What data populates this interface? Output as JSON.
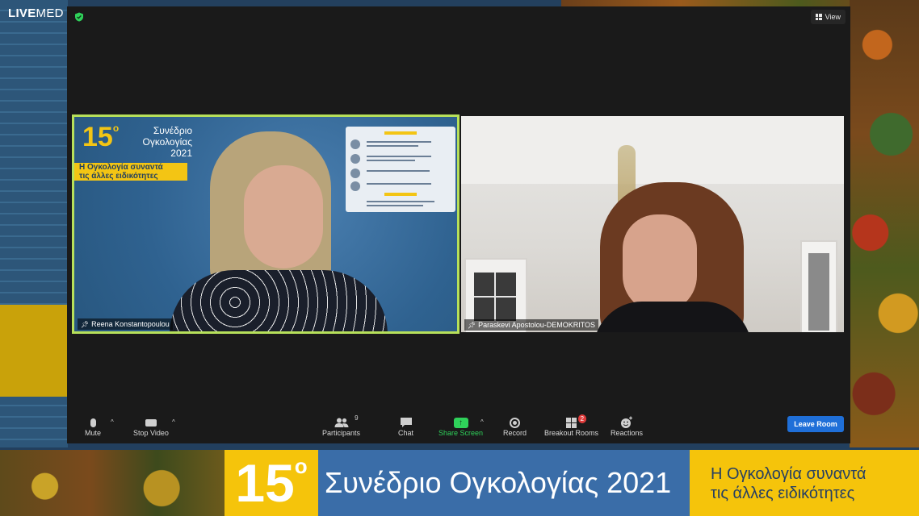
{
  "brand": {
    "live": "LIVE",
    "med": "MED"
  },
  "meeting": {
    "view_label": "View",
    "participants": [
      {
        "name": "Reena Konstantopoulou",
        "active_speaker": true
      },
      {
        "name": "Paraskevi Apostolou-DEMOKRITOS",
        "active_speaker": false
      }
    ],
    "tile1_poster": {
      "number": "15",
      "degree": "o",
      "line1": "Συνέδριο",
      "line2": "Ογκολογίας",
      "line3": "2021",
      "band1": "Η Ογκολογία συναντά",
      "band2": "τις άλλες ειδικότητες"
    },
    "toolbar": {
      "mute": "Mute",
      "stop_video": "Stop Video",
      "participants": "Participants",
      "participants_count": "9",
      "chat": "Chat",
      "share_screen": "Share Screen",
      "record": "Record",
      "breakout_rooms": "Breakout Rooms",
      "breakout_badge": "2",
      "reactions": "Reactions",
      "leave": "Leave Room",
      "caret": "^"
    },
    "colors": {
      "active_border": "#b7e05a",
      "share_green": "#2fd15a",
      "leave_blue": "#1f6fd8"
    }
  },
  "banner": {
    "number": "15",
    "degree": "o",
    "title": "Συνέδριο Ογκολογίας 2021",
    "tagline_line1": "Η Ογκολογία συναντά",
    "tagline_line2": "τις άλλες ειδικότητες",
    "colors": {
      "yellow": "#f5c40b",
      "blue": "#3a6da8"
    }
  }
}
